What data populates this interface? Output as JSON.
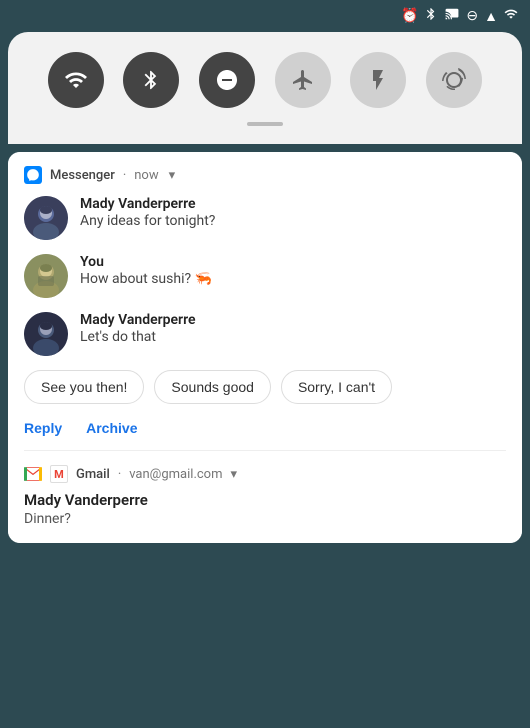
{
  "statusBar": {
    "icons": [
      "alarm",
      "bluetooth",
      "cast",
      "dnd",
      "wifi",
      "signal"
    ]
  },
  "quickSettings": {
    "buttons": [
      {
        "name": "wifi",
        "label": "▼",
        "active": true
      },
      {
        "name": "bluetooth",
        "label": "⚡",
        "active": true
      },
      {
        "name": "dnd",
        "label": "⊖",
        "active": true
      },
      {
        "name": "airplane",
        "label": "✈",
        "active": false
      },
      {
        "name": "flashlight",
        "label": "🔦",
        "active": false
      },
      {
        "name": "rotate",
        "label": "⟳",
        "active": false
      }
    ]
  },
  "messengerNotification": {
    "appName": "Messenger",
    "time": "now",
    "messages": [
      {
        "sender": "Mady Vanderperre",
        "text": "Any ideas for tonight?",
        "avatar": "mady"
      },
      {
        "sender": "You",
        "text": "How about sushi? 🦐",
        "avatar": "you"
      },
      {
        "sender": "Mady Vanderperre",
        "text": "Let's do that",
        "avatar": "mady"
      }
    ],
    "quickReplies": [
      "See you then!",
      "Sounds good",
      "Sorry, I can't"
    ],
    "actions": [
      "Reply",
      "Archive"
    ]
  },
  "gmailNotification": {
    "appName": "Gmail",
    "account": "van@gmail.com",
    "sender": "Mady Vanderperre",
    "subject": "Dinner?"
  }
}
